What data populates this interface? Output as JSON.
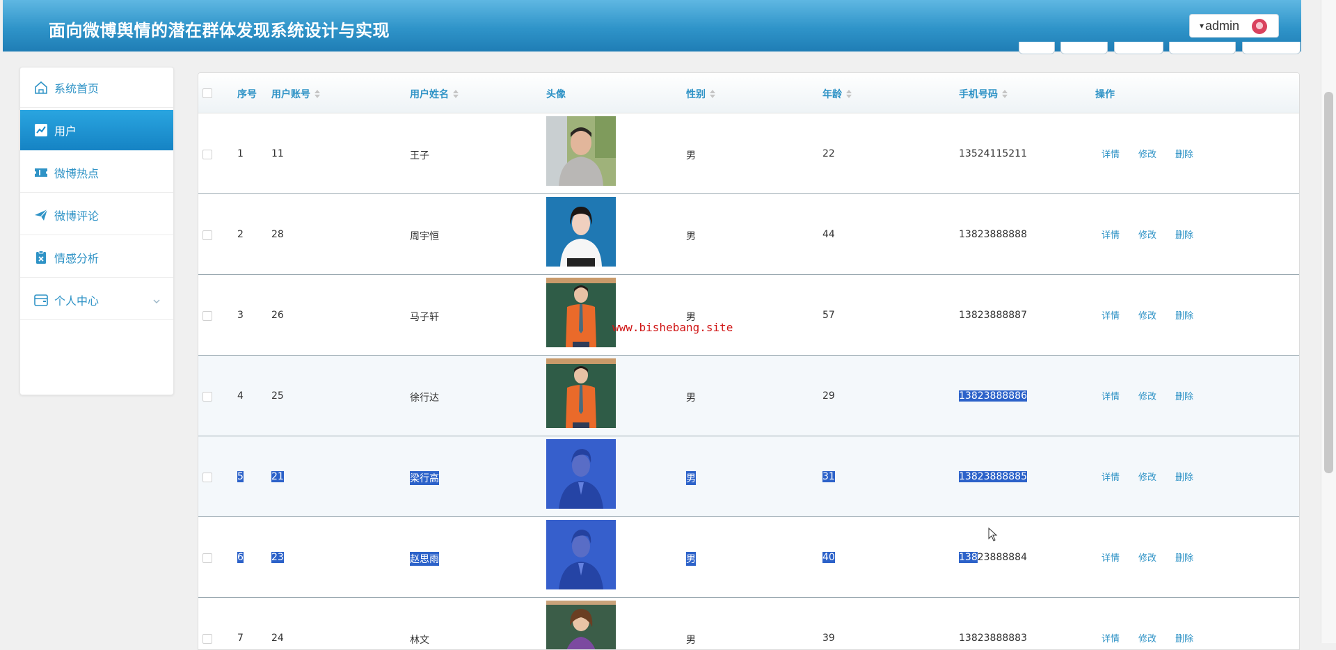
{
  "header": {
    "title": "面向微博舆情的潜在群体发现系统设计与实现",
    "user_label": "admin",
    "caret": "▾"
  },
  "sidebar": {
    "items": [
      {
        "label": "系统首页",
        "icon": "home-icon",
        "active": false
      },
      {
        "label": "用户",
        "icon": "chart-line-icon",
        "active": true
      },
      {
        "label": "微博热点",
        "icon": "ticket-icon",
        "active": false
      },
      {
        "label": "微博评论",
        "icon": "paper-plane-icon",
        "active": false
      },
      {
        "label": "情感分析",
        "icon": "clipboard-icon",
        "active": false
      },
      {
        "label": "个人中心",
        "icon": "wallet-icon",
        "active": false
      }
    ]
  },
  "table": {
    "headers": {
      "index": "序号",
      "account": "用户账号",
      "name": "用户姓名",
      "avatar": "头像",
      "gender": "性别",
      "age": "年龄",
      "phone": "手机号码",
      "ops": "操作"
    },
    "ops": {
      "detail": "详情",
      "edit": "修改",
      "delete": "删除"
    },
    "rows": [
      {
        "index": "1",
        "account": "11",
        "name": "王子",
        "gender": "男",
        "age": "22",
        "phone": "13524115211"
      },
      {
        "index": "2",
        "account": "28",
        "name": "周宇恒",
        "gender": "男",
        "age": "44",
        "phone": "13823888888"
      },
      {
        "index": "3",
        "account": "26",
        "name": "马子轩",
        "gender": "男",
        "age": "57",
        "phone": "13823888887"
      },
      {
        "index": "4",
        "account": "25",
        "name": "徐行达",
        "gender": "男",
        "age": "29",
        "phone": "13823888886"
      },
      {
        "index": "5",
        "account": "21",
        "name": "梁行高",
        "gender": "男",
        "age": "31",
        "phone": "13823888885"
      },
      {
        "index": "6",
        "account": "23",
        "name": "赵思雨",
        "gender": "男",
        "age": "40",
        "phone_selected_part": "138",
        "phone_rest": "23888884"
      },
      {
        "index": "7",
        "account": "24",
        "name": "林文",
        "gender": "男",
        "age": "39",
        "phone": "13823888883"
      }
    ]
  },
  "watermark": "www.bishebang.site",
  "colors": {
    "accent": "#2f93c6",
    "header": "#2f94c9",
    "selection": "#2c62c9"
  }
}
